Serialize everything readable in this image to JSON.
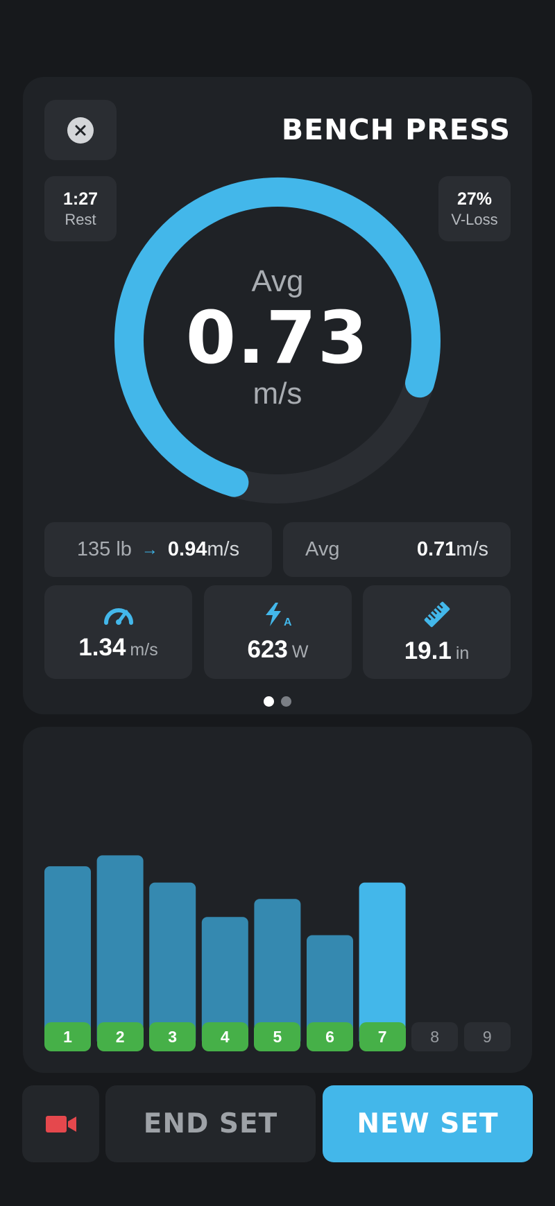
{
  "header": {
    "title": "BENCH PRESS",
    "close_icon": "close-icon"
  },
  "rest": {
    "value": "1:27",
    "label": "Rest"
  },
  "vloss": {
    "value": "27%",
    "label": "V-Loss"
  },
  "gauge": {
    "label": "Avg",
    "value": "0.73",
    "unit": "m/s",
    "fill_fraction": 0.7,
    "color": "#43b7ea",
    "track_color": "#2a2d32"
  },
  "load": {
    "weight": "135 lb",
    "arrow": "→",
    "velocity": "0.94",
    "unit": "m/s"
  },
  "average": {
    "label": "Avg",
    "value": "0.71",
    "unit": "m/s"
  },
  "metrics": [
    {
      "icon": "speedometer-icon",
      "value": "1.34",
      "unit": "m/s"
    },
    {
      "icon": "power-bolt-icon",
      "value": "623",
      "unit": "W"
    },
    {
      "icon": "ruler-icon",
      "value": "19.1",
      "unit": "in"
    }
  ],
  "pager": {
    "pages": 2,
    "active": 0
  },
  "chart_data": {
    "type": "bar",
    "categories": [
      "1",
      "2",
      "3",
      "4",
      "5",
      "6",
      "7",
      "8",
      "9"
    ],
    "values": [
      0.99,
      1.05,
      0.9,
      0.71,
      0.81,
      0.61,
      0.9,
      null,
      null
    ],
    "ylim": [
      0,
      1.3
    ],
    "completed_reps": 7,
    "current_rep": 7,
    "bar_color": "#3589b0",
    "current_bar_color": "#43b7ea",
    "done_label_color": "#46b048"
  },
  "controls": {
    "video_icon": "video-camera-icon",
    "end_label": "END SET",
    "new_label": "NEW SET"
  },
  "colors": {
    "accent": "#43b7ea",
    "success": "#46b048",
    "record": "#e5484d"
  }
}
